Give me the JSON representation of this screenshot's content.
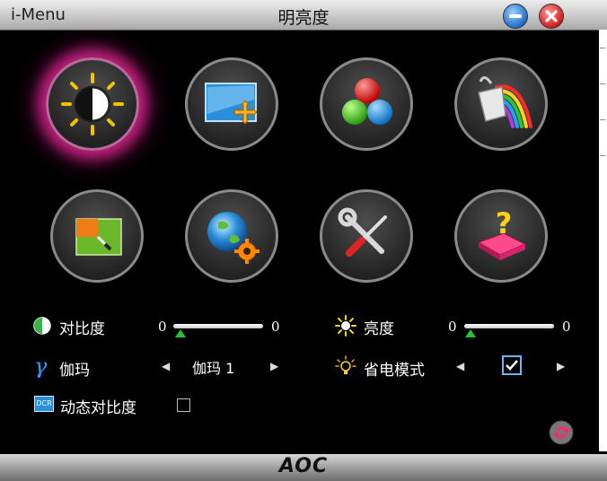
{
  "titlebar": {
    "app_name": "i-Menu",
    "title": "明亮度"
  },
  "icons": [
    {
      "name": "brightness"
    },
    {
      "name": "picture-boost"
    },
    {
      "name": "color-setup"
    },
    {
      "name": "paint"
    },
    {
      "name": "picture-setup"
    },
    {
      "name": "osd-setup"
    },
    {
      "name": "extra-tools"
    },
    {
      "name": "factory-reset"
    }
  ],
  "settings": {
    "contrast": {
      "label": "对比度",
      "min": "0",
      "max": "0",
      "value": 0
    },
    "brightness": {
      "label": "亮度",
      "min": "0",
      "max": "0",
      "value": 0
    },
    "gamma": {
      "label": "伽玛",
      "value": "伽玛 1"
    },
    "eco_mode": {
      "label": "省电模式",
      "checked": true
    },
    "dcr": {
      "label": "动态对比度",
      "checked": false
    }
  },
  "footer": {
    "logo": "AOC"
  },
  "colors": {
    "selection_glow": "#e0249b",
    "slider_thumb": "#21c43a",
    "checkbox_accent": "#6fb3ff"
  }
}
